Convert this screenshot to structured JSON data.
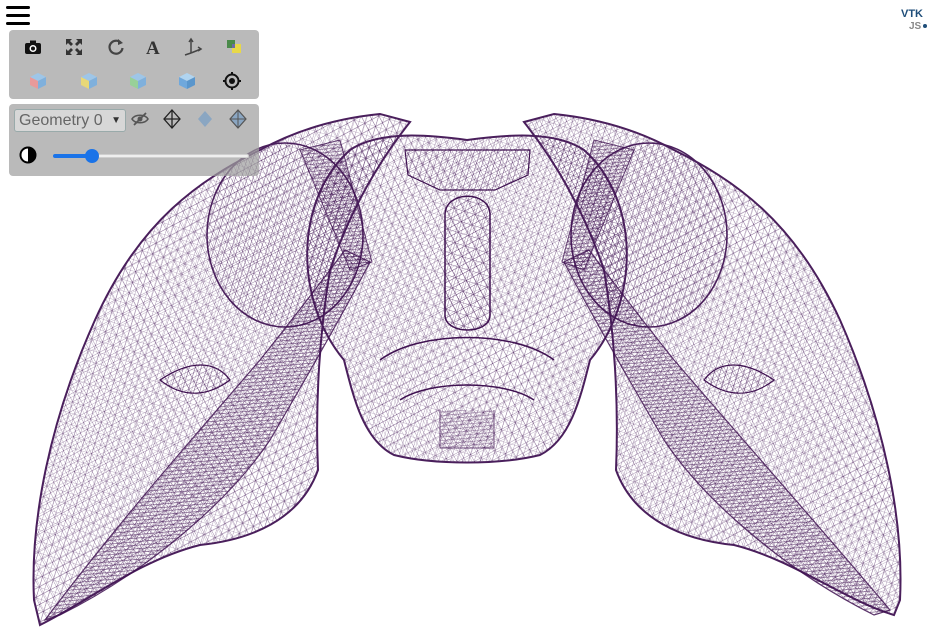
{
  "logo": {
    "line1": "VTK",
    "line2": "JS"
  },
  "toolbar": {
    "row1": [
      {
        "name": "screenshot",
        "icon": "camera-icon"
      },
      {
        "name": "reset-camera",
        "icon": "expand-icon"
      },
      {
        "name": "rotate",
        "icon": "rotate-icon"
      },
      {
        "name": "annotations",
        "icon": "text-icon"
      },
      {
        "name": "orientation-axes",
        "icon": "axes-icon"
      },
      {
        "name": "background",
        "icon": "color-palette-icon"
      }
    ],
    "row2": [
      {
        "name": "view-x",
        "icon": "cube-red-icon"
      },
      {
        "name": "view-y",
        "icon": "cube-yellow-icon"
      },
      {
        "name": "view-z",
        "icon": "cube-green-icon"
      },
      {
        "name": "view-iso",
        "icon": "cube-blue-icon"
      },
      {
        "name": "center-focus",
        "icon": "target-icon"
      }
    ]
  },
  "geometry": {
    "selected": "Geometry 0",
    "opacity": 0.2
  },
  "mesh": {
    "color": "#4a1f5c"
  }
}
